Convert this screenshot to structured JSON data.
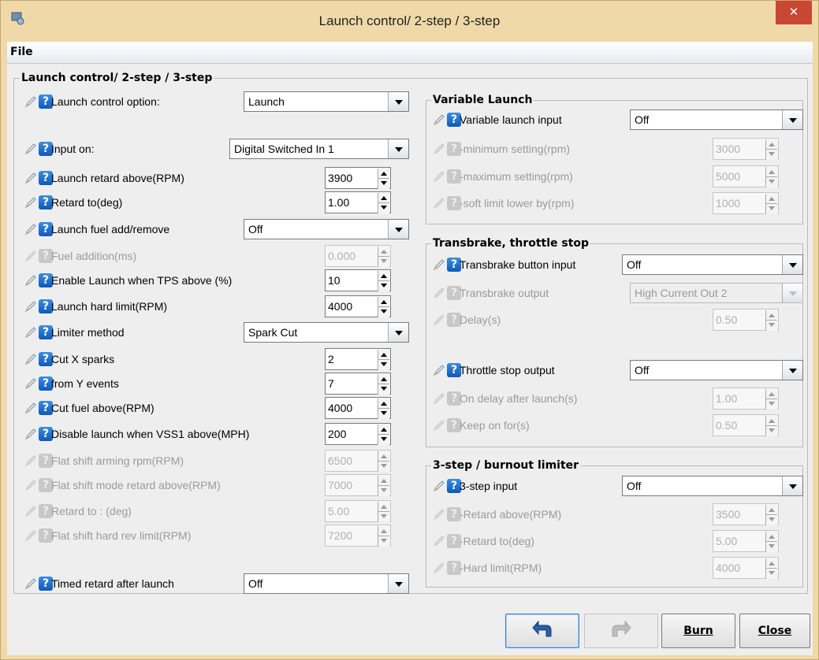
{
  "window": {
    "title": "Launch control/ 2-step / 3-step",
    "close_glyph": "✕"
  },
  "menu": {
    "file_label": "File"
  },
  "main_group": {
    "legend": "Launch control/ 2-step / 3-step",
    "fields": [
      {
        "label": "Launch control option:",
        "kind": "combo",
        "value": "Launch",
        "enabled": true
      },
      {
        "label": "Input on:",
        "kind": "combo",
        "value": "Digital Switched In 1",
        "enabled": true
      },
      {
        "label": "Launch retard above(RPM)",
        "kind": "spin",
        "value": "3900",
        "enabled": true
      },
      {
        "label": "Retard to(deg)",
        "kind": "spin",
        "value": "1.00",
        "enabled": true
      },
      {
        "label": "Launch fuel add/remove",
        "kind": "combo",
        "value": "Off",
        "enabled": true
      },
      {
        "label": "Fuel addition(ms)",
        "kind": "spin",
        "value": "0.000",
        "enabled": false
      },
      {
        "label": "Enable Launch when TPS above  (%)",
        "kind": "spin",
        "value": "10",
        "enabled": true
      },
      {
        "label": "Launch hard limit(RPM)",
        "kind": "spin",
        "value": "4000",
        "enabled": true
      },
      {
        "label": "Limiter method",
        "kind": "combo",
        "value": "Spark Cut",
        "enabled": true
      },
      {
        "label": "Cut X sparks",
        "kind": "spin",
        "value": "2",
        "enabled": true
      },
      {
        "label": "from Y events",
        "kind": "spin",
        "value": "7",
        "enabled": true
      },
      {
        "label": "Cut fuel above(RPM)",
        "kind": "spin",
        "value": "4000",
        "enabled": true
      },
      {
        "label": "Disable launch when VSS1 above(MPH)",
        "kind": "spin",
        "value": "200",
        "enabled": true
      },
      {
        "label": "Flat shift arming rpm(RPM)",
        "kind": "spin",
        "value": "6500",
        "enabled": false
      },
      {
        "label": "Flat shift mode retard above(RPM)",
        "kind": "spin",
        "value": "7000",
        "enabled": false
      },
      {
        "label": "Retard to :  (deg)",
        "kind": "spin",
        "value": "5.00",
        "enabled": false
      },
      {
        "label": "Flat shift hard rev limit(RPM)",
        "kind": "spin",
        "value": "7200",
        "enabled": false
      },
      {
        "label": "Timed retard after launch",
        "kind": "combo",
        "value": "Off",
        "enabled": true
      }
    ]
  },
  "variable_launch": {
    "legend": "Variable Launch",
    "fields": [
      {
        "label": "Variable launch input",
        "kind": "combo",
        "value": "Off",
        "enabled": true
      },
      {
        "label": "-minimum setting(rpm)",
        "kind": "spin",
        "value": "3000",
        "enabled": false
      },
      {
        "label": "-maximum setting(rpm)",
        "kind": "spin",
        "value": "5000",
        "enabled": false
      },
      {
        "label": "-soft limit lower by(rpm)",
        "kind": "spin",
        "value": "1000",
        "enabled": false
      }
    ]
  },
  "transbrake": {
    "legend": "Transbrake, throttle stop",
    "fields": [
      {
        "label": "Transbrake button input",
        "kind": "combo",
        "value": "Off",
        "enabled": true
      },
      {
        "label": "Transbrake output",
        "kind": "combo",
        "value": "High Current Out 2",
        "enabled": false
      },
      {
        "label": "Delay(s)",
        "kind": "spin",
        "value": "0.50",
        "enabled": false
      },
      {
        "label": "Throttle stop output",
        "kind": "combo",
        "value": "Off",
        "enabled": true
      },
      {
        "label": "On delay after launch(s)",
        "kind": "spin",
        "value": "1.00",
        "enabled": false
      },
      {
        "label": "Keep on for(s)",
        "kind": "spin",
        "value": "0.50",
        "enabled": false
      }
    ]
  },
  "three_step": {
    "legend": "3-step / burnout limiter",
    "fields": [
      {
        "label": "3-step input",
        "kind": "combo",
        "value": "Off",
        "enabled": true
      },
      {
        "label": "-Retard above(RPM)",
        "kind": "spin",
        "value": "3500",
        "enabled": false
      },
      {
        "label": "-Retard to(deg)",
        "kind": "spin",
        "value": "5.00",
        "enabled": false
      },
      {
        "label": "-Hard limit(RPM)",
        "kind": "spin",
        "value": "4000",
        "enabled": false
      }
    ]
  },
  "footer": {
    "undo_icon": "undo-arrow-icon",
    "redo_icon": "redo-arrow-icon",
    "burn_label": "Burn",
    "close_label": "Close"
  },
  "colors": {
    "help_icon_blue": "#1a6fd0",
    "title_close_red": "#c84733",
    "window_frame": "#f0d9a8"
  }
}
